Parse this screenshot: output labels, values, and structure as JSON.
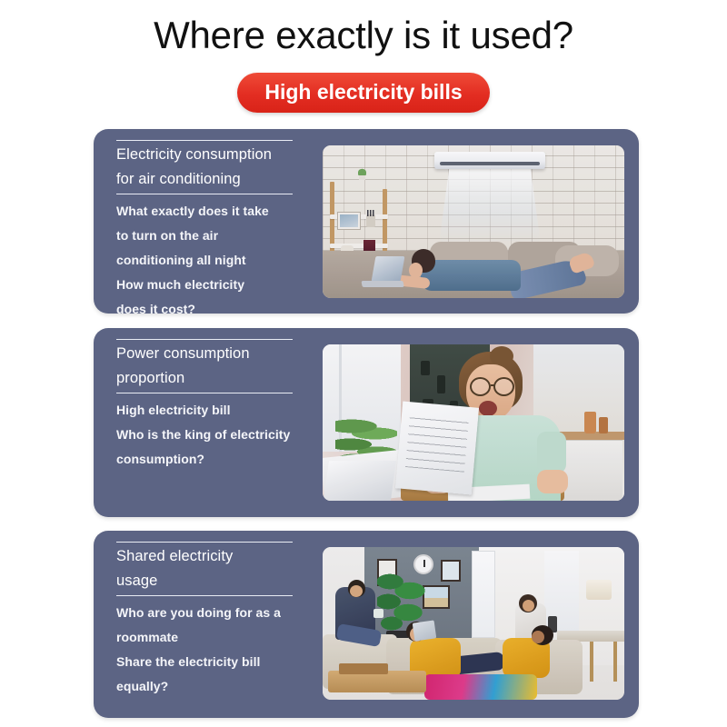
{
  "header": {
    "title": "Where exactly is it used?",
    "badge": "High electricity bills",
    "badge_color": "#e32d22",
    "title_color": "#111111"
  },
  "theme": {
    "card_background": "#5c6484",
    "page_background": "#ffffff",
    "card_text_color": "#ffffff",
    "rule_color": "#e9ecf4"
  },
  "cards": [
    {
      "title": "Electricity consumption for air conditioning",
      "title_line_1": "Electricity consumption",
      "title_line_2": "for air conditioning",
      "body_lines": [
        "What exactly does it take",
        "to turn on the air",
        "conditioning all night",
        "How much electricity",
        "does it cost?"
      ],
      "image_alt": "Woman lying on a couch with a laptop under a wall-mounted air conditioner blowing cold air in a white brick room"
    },
    {
      "title": "Power consumption proportion",
      "title_line_1": "Power consumption",
      "title_line_2": "proportion",
      "body_lines": [
        "High electricity bill",
        "Who is the king of electricity",
        "consumption?"
      ],
      "image_alt": "Shocked woman with glasses in a mint green t-shirt reading an electricity bill at a kitchen table"
    },
    {
      "title": "Shared electricity usage",
      "title_line_1": "Shared electricity",
      "title_line_2": "usage",
      "body_lines": [
        "Who are you doing for as a",
        "roommate",
        "Share the electricity bill",
        "equally?"
      ],
      "image_alt": "Group of roommates relaxing on sofas with phones and tablets in a shared living room"
    }
  ]
}
